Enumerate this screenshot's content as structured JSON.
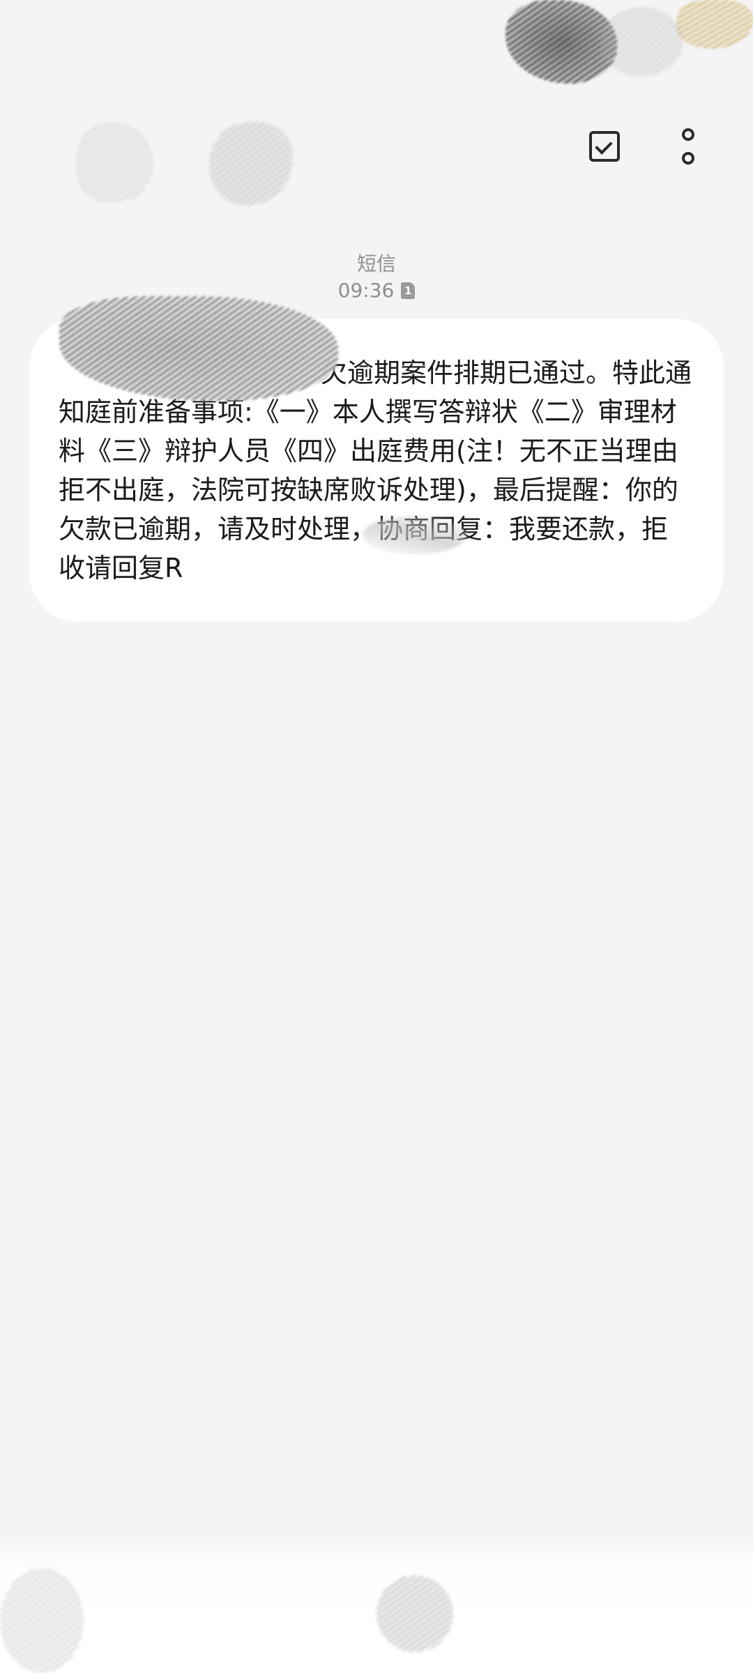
{
  "header": {
    "sender": "短信",
    "time": "09:36",
    "sim_slot": "1"
  },
  "toolbar": {
    "select_icon": "checkbox-icon",
    "more_icon": "more-vert-icon"
  },
  "message": {
    "text": "欠逾期案件排期已通过。特此通知庭前准备事项:《一》本人撰写答辩状《二》审理材料《三》辩护人员《四》出庭费用(注！无不正当理由拒不出庭，法院可按缺席败诉处理)，最后提醒：你的欠款已逾期，请及时处理，协商回复：我要还款，拒收请回复R"
  },
  "colors": {
    "background": "#f4f4f4",
    "bubble": "#ffffff",
    "meta_text": "#8e8e8e",
    "message_text": "#1a1a1a"
  }
}
